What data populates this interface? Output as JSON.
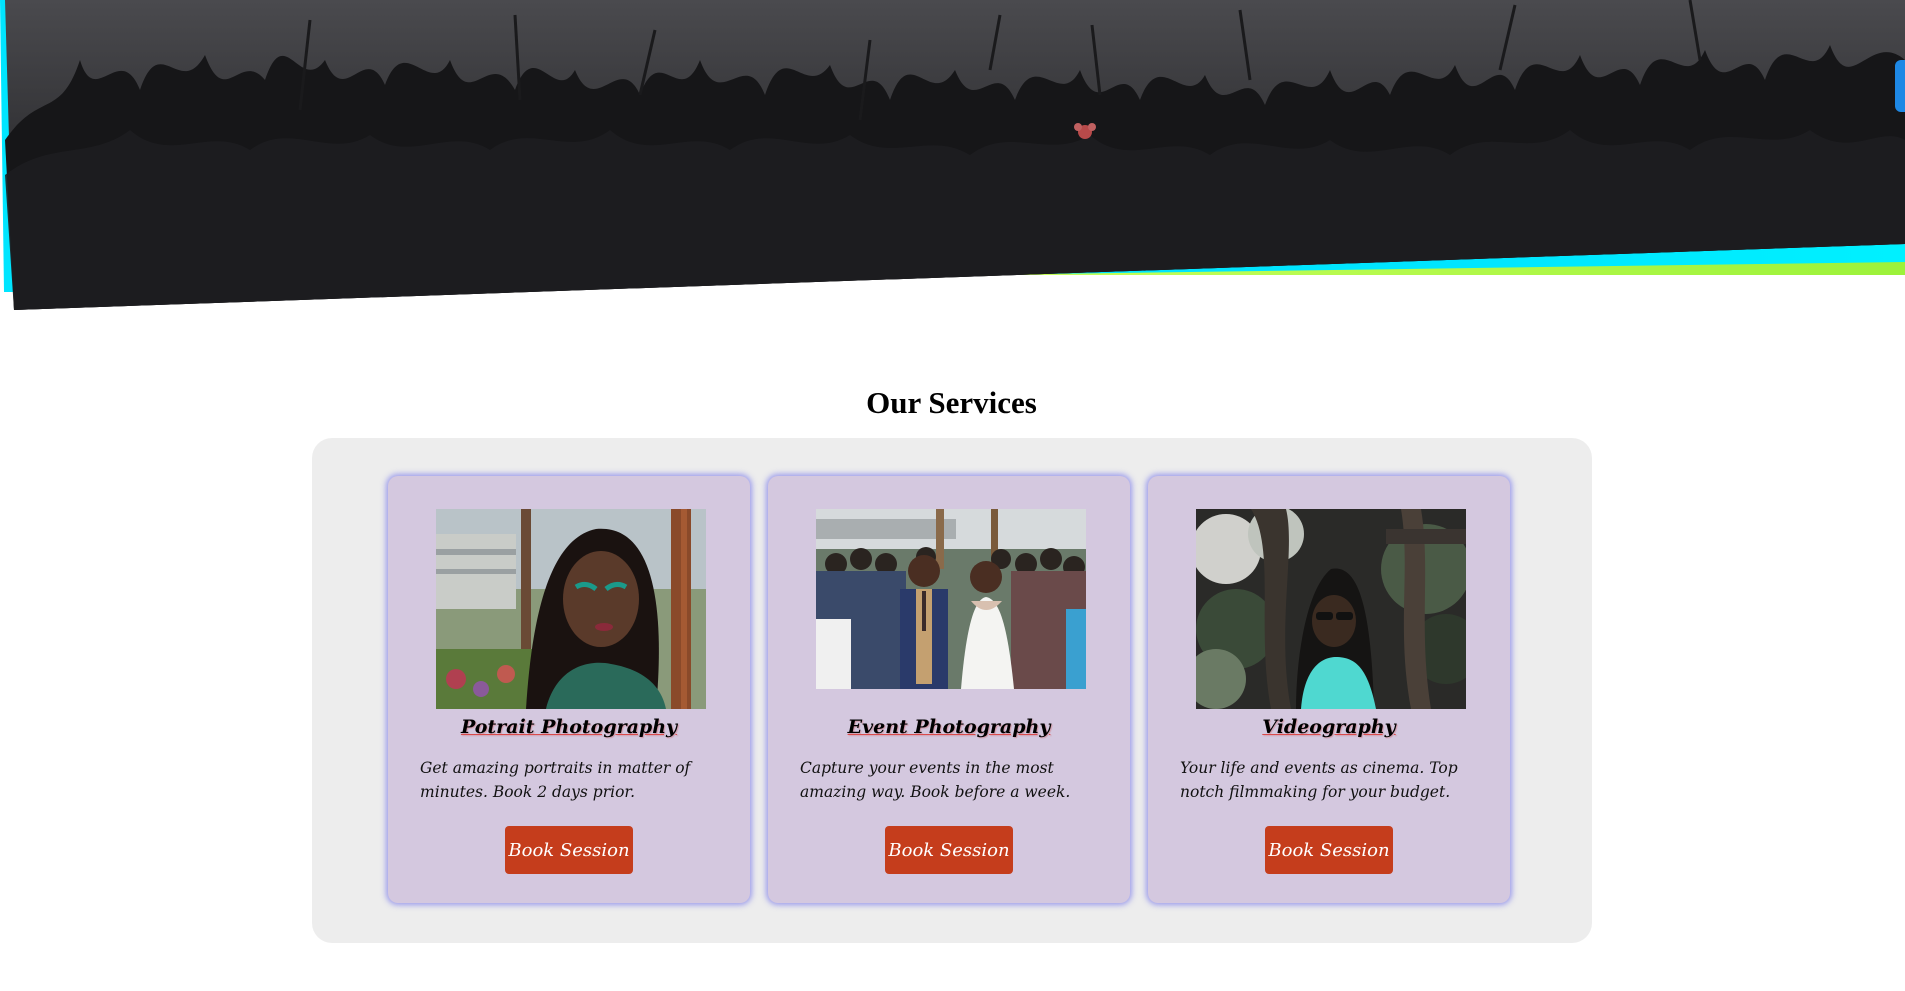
{
  "services": {
    "title": "Our Services",
    "book_label": "Book Session",
    "cards": [
      {
        "title": "Potrait Photography",
        "description": "Get amazing portraits in matter of minutes. Book 2 days prior."
      },
      {
        "title": "Event Photography",
        "description": "Capture your events in the most amazing way. Book before a week."
      },
      {
        "title": "Videography",
        "description": "Your life and events as cinema. Top notch filmmaking for your budget."
      }
    ]
  },
  "colors": {
    "hero_dark": "#18181a",
    "accent_cyan": "#00e5ff",
    "accent_lime": "#a8ff3e",
    "card_bg": "#d4c8df",
    "panel_bg": "#ededed",
    "button_bg": "#c53d1c",
    "side_tab": "#1e88e5"
  }
}
